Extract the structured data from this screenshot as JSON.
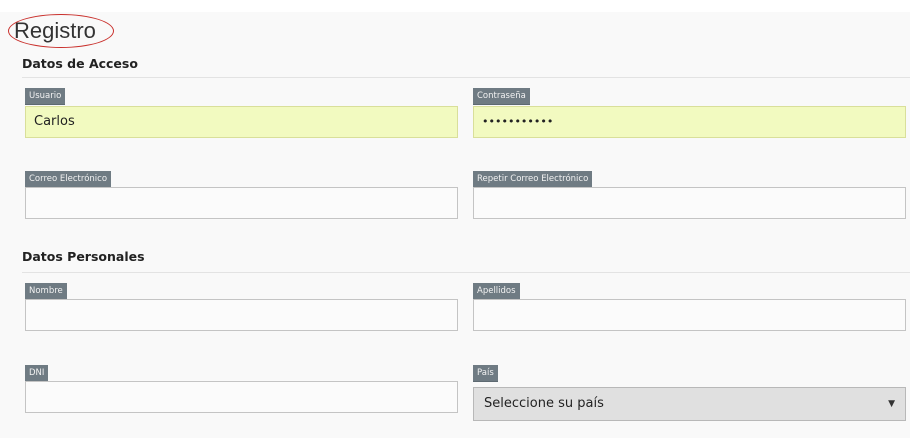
{
  "page": {
    "title": "Registro"
  },
  "sections": {
    "access": {
      "title": "Datos de Acceso",
      "usuario": {
        "label": "Usuario",
        "value": "Carlos"
      },
      "contrasena": {
        "label": "Contraseña",
        "value": "•••••••••••"
      },
      "correo": {
        "label": "Correo Electrónico",
        "value": ""
      },
      "repetir_correo": {
        "label": "Repetir Correo Electrónico",
        "value": ""
      }
    },
    "personal": {
      "title": "Datos Personales",
      "nombre": {
        "label": "Nombre",
        "value": ""
      },
      "apellidos": {
        "label": "Apellidos",
        "value": ""
      },
      "dni": {
        "label": "DNI",
        "value": ""
      },
      "pais": {
        "label": "País",
        "selected": "Seleccione su país"
      }
    }
  },
  "colors": {
    "label_bg": "#6f7b83",
    "filled_input_bg": "#f2fac0",
    "title_ring": "#c9302c"
  },
  "icons": {
    "select_arrow": "chevron-down-icon"
  }
}
